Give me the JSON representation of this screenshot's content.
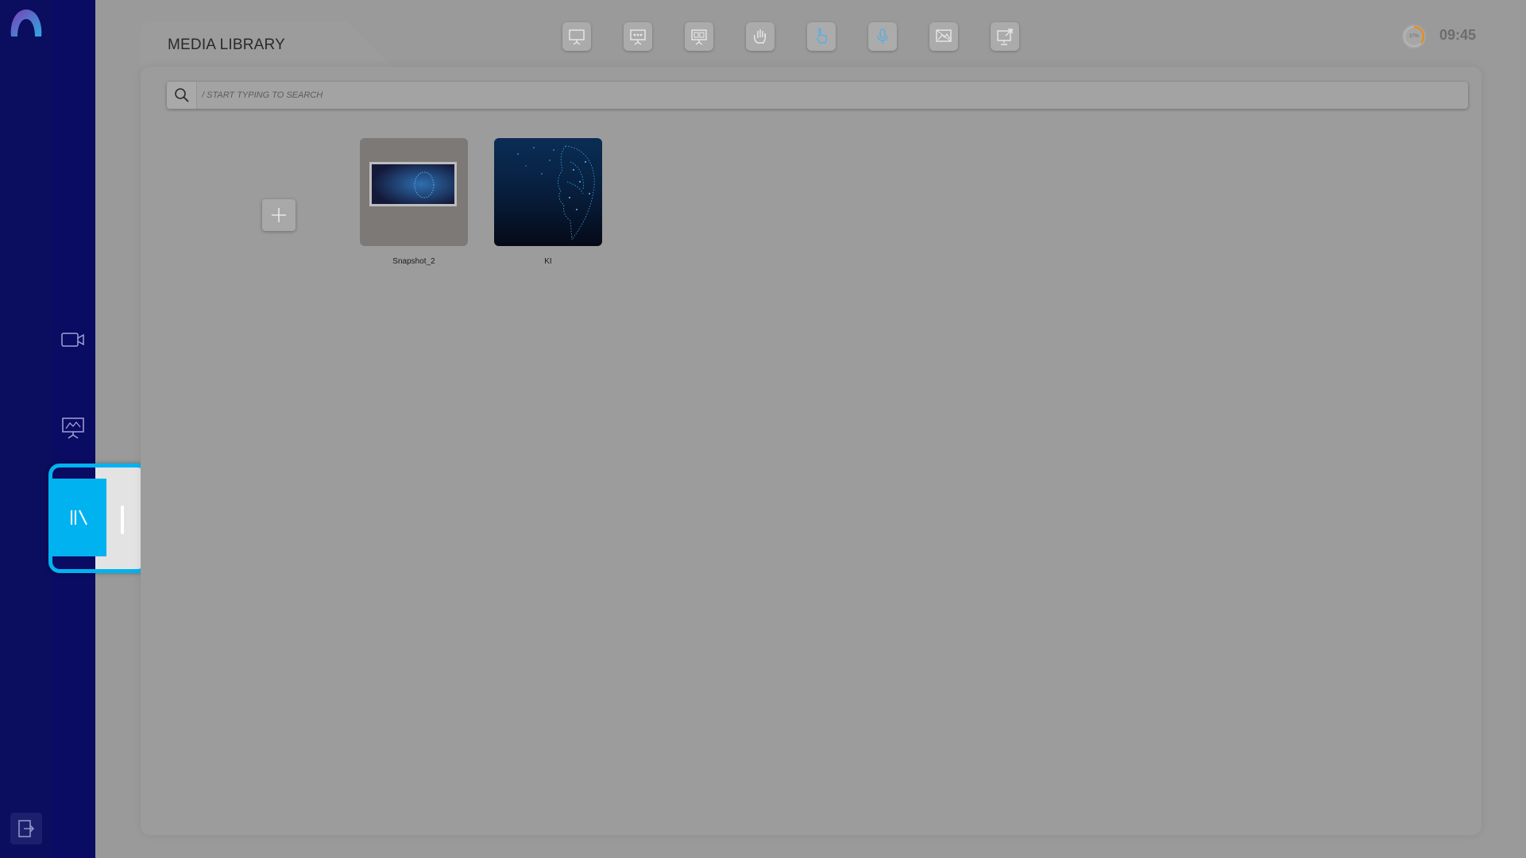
{
  "app": {
    "panel_title": "MEDIA LIBRARY",
    "clock": "09:45",
    "status_ring": {
      "label": "37%",
      "value": 0.37,
      "color": "#f08a00"
    }
  },
  "colors": {
    "rail": "#0b0d5e",
    "highlight": "#00b3f0",
    "background": "#9a9a9a"
  },
  "sidebar": {
    "items": [
      {
        "name": "video-camera-icon",
        "active": false
      },
      {
        "name": "presentation-board-icon",
        "active": false
      },
      {
        "name": "library-icon",
        "active": true
      }
    ],
    "exit_icon": "exit-icon"
  },
  "toolbar": {
    "icons": [
      "presentation-screen-icon",
      "audience-screen-icon",
      "multi-screen-icon",
      "raised-hand-icon",
      "touch-pointer-icon",
      "microphone-icon",
      "image-frame-icon",
      "screen-share-icon"
    ]
  },
  "search": {
    "placeholder": "/ START TYPING TO SEARCH",
    "value": ""
  },
  "media": {
    "add_icon": "plus-icon",
    "items": [
      {
        "label": "Snapshot_2",
        "thumbnail": "snapshot-photo"
      },
      {
        "label": "KI",
        "thumbnail": "digital-face"
      }
    ]
  }
}
